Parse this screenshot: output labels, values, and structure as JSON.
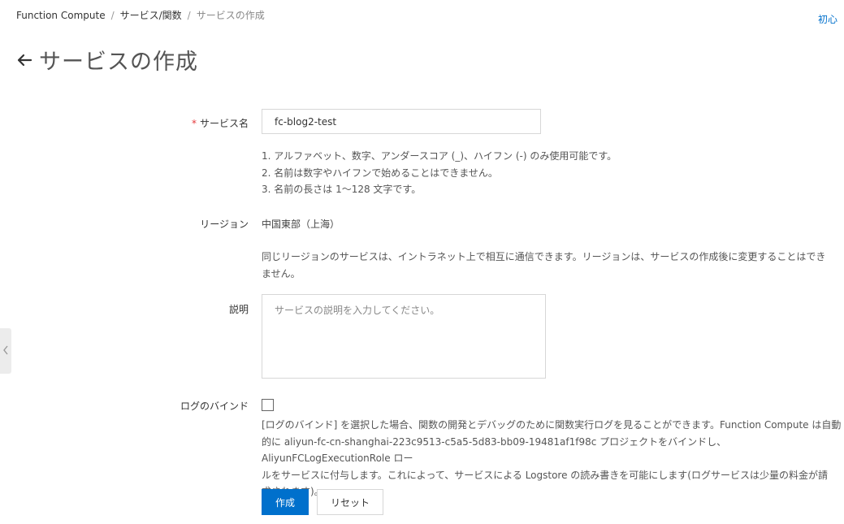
{
  "breadcrumb": {
    "items": [
      "Function Compute",
      "サービス/関数",
      "サービスの作成"
    ],
    "separator": "/"
  },
  "top_link": "初心",
  "page": {
    "title": "サービスの作成"
  },
  "form": {
    "service_name": {
      "label": "サービス名",
      "required_mark": "*",
      "value": "fc-blog2-test",
      "help": [
        "1. アルファベット、数字、アンダースコア (_)、ハイフン (-) のみ使用可能です。",
        "2. 名前は数字やハイフンで始めることはできません。",
        "3. 名前の長さは 1〜128 文字です。"
      ]
    },
    "region": {
      "label": "リージョン",
      "value": "中国東部（上海）",
      "help": [
        "同じリージョンのサービスは、イントラネット上で相互に通信できます。リージョンは、サービスの作成後に変更することはでき",
        "ません。"
      ]
    },
    "description": {
      "label": "説明",
      "placeholder": "サービスの説明を入力してください。",
      "value": ""
    },
    "log_bind": {
      "label": "ログのバインド",
      "checked": false,
      "help": [
        "[ログのバインド] を選択した場合、関数の開発とデバッグのために関数実行ログを見ることができます。Function Compute は自動",
        "的に aliyun-fc-cn-shanghai-223c9513-c5a5-5d83-bb09-19481af1f98c プロジェクトをバインドし、AliyunFCLogExecutionRole ロー",
        "ルをサービスに付与します。これによって、サービスによる Logstore の読み書きを可能にします(ログサービスは少量の料金が請",
        "求されます)。"
      ]
    }
  },
  "actions": {
    "create_label": "作成",
    "reset_label": "リセット"
  },
  "colors": {
    "primary": "#0070cc",
    "required": "#e4393c",
    "link": "#0070cc"
  }
}
